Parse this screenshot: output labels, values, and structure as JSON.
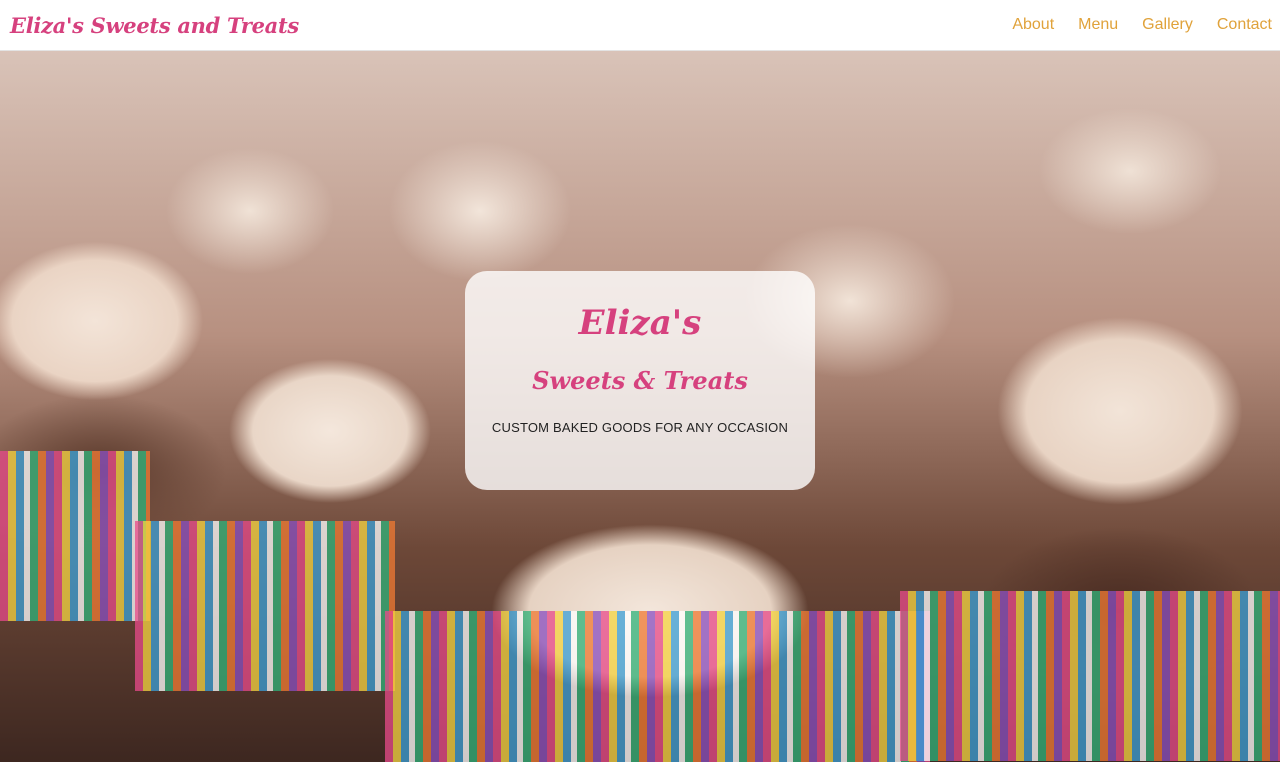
{
  "navbar": {
    "brand": "Eliza's Sweets and Treats",
    "links": [
      {
        "label": "About"
      },
      {
        "label": "Menu"
      },
      {
        "label": "Gallery"
      },
      {
        "label": "Contact"
      }
    ]
  },
  "hero": {
    "image": "cupcakes-photo",
    "card": {
      "title": "Eliza's",
      "subtitle": "Sweets & Treats",
      "tagline": "CUSTOM BAKED GOODS FOR ANY OCCASION"
    }
  },
  "colors": {
    "brand_pink": "#d6417e",
    "nav_link_gold": "#e0a23a",
    "card_background": "rgba(255,255,255,0.80)"
  }
}
